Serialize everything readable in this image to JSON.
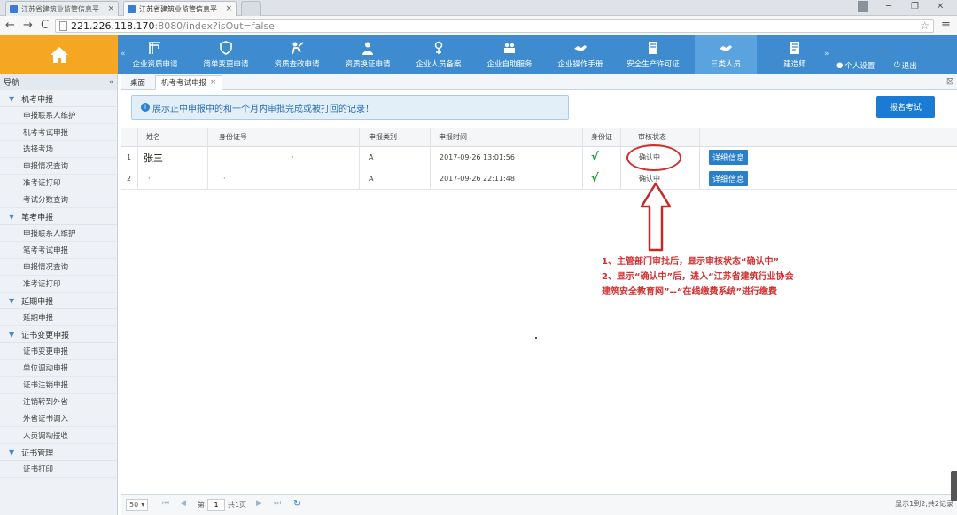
{
  "browser": {
    "tabs": [
      {
        "label": "江苏省建筑业监管信息平"
      },
      {
        "label": "江苏省建筑业监管信息平"
      }
    ],
    "url_host": "221.226.118.170",
    "url_rest": ":8080/index?isOut=false"
  },
  "header": {
    "nav": [
      {
        "label": "企业资质申请",
        "icon": "crane-icon"
      },
      {
        "label": "简单变更申请",
        "icon": "shield-icon"
      },
      {
        "label": "资质查改申请",
        "icon": "worker-icon"
      },
      {
        "label": "资质换证申请",
        "icon": "user-tie-icon"
      },
      {
        "label": "企业人员备案",
        "icon": "id-card-icon"
      },
      {
        "label": "企业自助服务",
        "icon": "people-icon"
      },
      {
        "label": "企业操作手册",
        "icon": "handshake-icon"
      },
      {
        "label": "安全生产许可证",
        "icon": "book-icon"
      },
      {
        "label": "三类人员",
        "icon": "handshake-icon"
      },
      {
        "label": "建造师",
        "icon": "document-icon"
      }
    ],
    "user_settings": "个人设置",
    "logout": "退出"
  },
  "sidebar": {
    "title": "导航",
    "groups": [
      {
        "label": "机考申报",
        "items": [
          "申报联系人维护",
          "机考考试申报",
          "选择考场",
          "申报情况查询",
          "准考证打印",
          "考试分数查询"
        ]
      },
      {
        "label": "笔考申报",
        "items": [
          "申报联系人维护",
          "笔考考试申报",
          "申报情况查询",
          "准考证打印"
        ]
      },
      {
        "label": "延期申报",
        "items": [
          "延期申报"
        ]
      },
      {
        "label": "证书变更申报",
        "items": [
          "证书变更申报",
          "单位调动申报",
          "证书注销申报",
          "注销转到外省",
          "外省证书调入",
          "人员调动接收"
        ]
      },
      {
        "label": "证书管理",
        "items": [
          "证书打印"
        ]
      }
    ]
  },
  "content": {
    "tabs": [
      {
        "label": "桌面"
      },
      {
        "label": "机考考试申报"
      }
    ],
    "notice": "展示正中申报中的和一个月内审批完成或被打回的记录！",
    "register_button": "报名考试",
    "columns": {
      "name": "姓名",
      "id_no": "身份证号",
      "category": "申报类别",
      "time": "申报时间",
      "id_card": "身份证",
      "status": "审核状态"
    },
    "rows": [
      {
        "index": "1",
        "name": "张三",
        "id_no": "·",
        "category": "A",
        "time": "2017-09-26 13:01:56",
        "check": "√",
        "status": "确认中",
        "action": "详细信息"
      },
      {
        "index": "2",
        "name": "·",
        "id_no": "·",
        "category": "A",
        "time": "2017-09-26 22:11:48",
        "check": "√",
        "status": "确认中",
        "action": "详细信息"
      }
    ],
    "annotation": [
      "1、主管部门审批后，显示审核状态“确认中”",
      "2、显示“确认中”后，进入“江苏省建筑行业协会",
      "建筑安全教育网”--“在线缴费系统”进行缴费"
    ],
    "pager": {
      "page_size": "50",
      "page_prefix": "第",
      "page_value": "1",
      "page_suffix": "共1页",
      "summary": "显示1到2,共2记录"
    }
  },
  "colors": {
    "header": "#3e8ccf",
    "home": "#f5a623",
    "annotation": "#d32f2f",
    "button": "#1a7ad4"
  }
}
